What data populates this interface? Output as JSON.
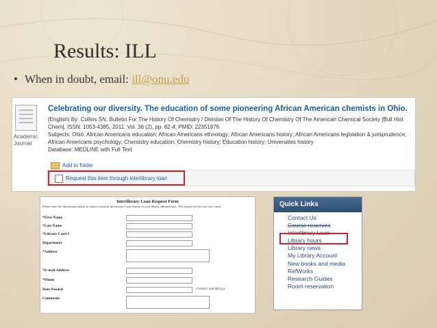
{
  "slide": {
    "title": "Results: ILL",
    "bullet_text": "When in doubt, email: ",
    "bullet_link": "ill@onu.edu"
  },
  "result": {
    "type_label": "Academic Journal",
    "title": "Celebrating our diversity. The education of some pioneering African American chemists in Ohio.",
    "meta_line1": "(English) By: Collins SN, Bulletin For The History Of Chemistry / Division Of The History Of Chemistry Of The American Chemical Society [Bull Hist Chem], ISSN: 1053-4385, 2011; Vol. 36 (2), pp. 82-4; PMID: 22351976",
    "meta_line2": "Subjects: Ohio; African Americans education; African Americans ethnology; African Americans history; African Americans legislation & jurisprudence; African Americans psychology; Chemistry education; Chemistry history; Education history; Universities history",
    "meta_line3": "Database: MEDLINE with Full Text",
    "add_folder": "Add to folder",
    "ill_request": "Request this item through interlibrary loan"
  },
  "form": {
    "title": "Interlibrary Loan Request Form",
    "intro": "Please enter the information below in order to send an Interlibrary Loan request to your library administrator. The request will be sent via e-mail.",
    "fields": [
      {
        "label": "*First Name"
      },
      {
        "label": "*Last Name"
      },
      {
        "label": "*Library Card #"
      },
      {
        "label": "Department"
      },
      {
        "label": "*Address"
      },
      {
        "label": "*E-mail Address"
      },
      {
        "label": "*Phone"
      },
      {
        "label": "Date Needed",
        "hint": "Format: mm/dd/yyyy"
      },
      {
        "label": "Comments"
      }
    ]
  },
  "quick_links": {
    "header": "Quick Links",
    "items": [
      "Contact Us",
      "Course reserves",
      "Interlibrary Loan",
      "Library hours",
      "Library news",
      "My Library Account",
      "New books and media",
      "RefWorks",
      "Research Guides",
      "Room reservation"
    ]
  },
  "colors": {
    "link": "#1a5ca8",
    "highlight": "#d0202a",
    "email_link": "#c0a24b"
  }
}
